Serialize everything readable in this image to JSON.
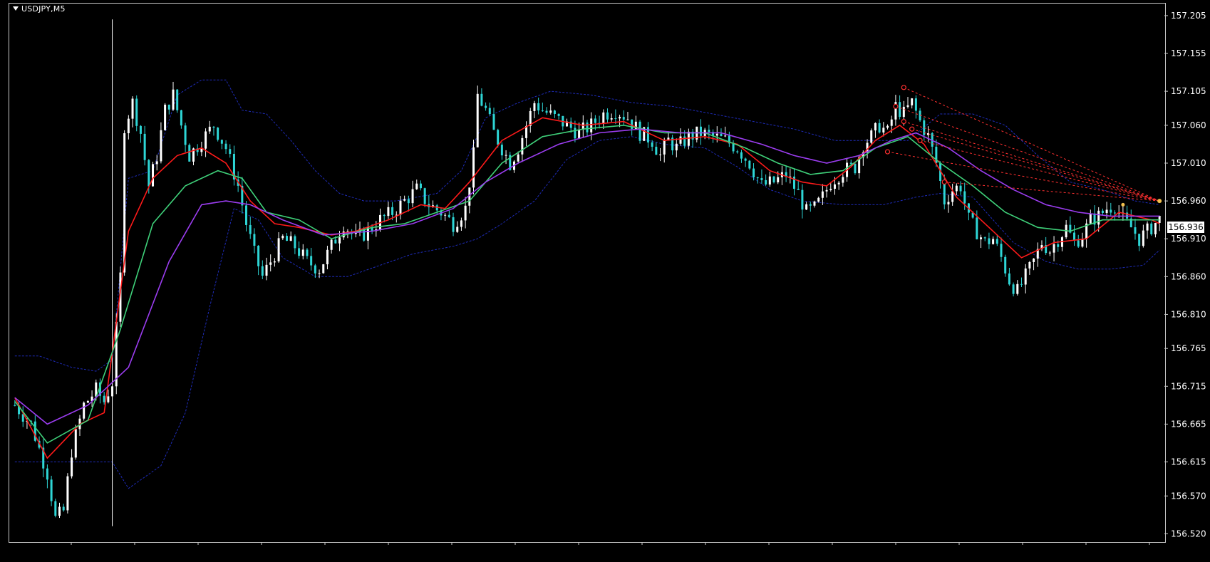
{
  "window": {
    "symbol_label": "USDJPY,M5"
  },
  "current_price": "156.936",
  "colors": {
    "background": "#000000",
    "bull_candle": "#ffffff",
    "bear_candle": "#2ed6d6",
    "ma_fast": "#ff1a1a",
    "ma_mid": "#3fd17a",
    "ma_slow": "#9b3df0",
    "bands": "#1e2bb8",
    "trend_lines": "#ff3030"
  },
  "chart_data": {
    "type": "candlestick",
    "symbol": "USDJPY",
    "timeframe": "M5",
    "ylim": [
      156.51,
      157.22
    ],
    "y_ticks": [
      "157.205",
      "157.155",
      "157.105",
      "157.060",
      "157.010",
      "156.960",
      "156.910",
      "156.860",
      "156.810",
      "156.765",
      "156.715",
      "156.665",
      "156.615",
      "156.570",
      "156.520"
    ],
    "close_path": [
      [
        0,
        156.69
      ],
      [
        4,
        156.665
      ],
      [
        8,
        156.6
      ],
      [
        10,
        156.54
      ],
      [
        12,
        156.55
      ],
      [
        14,
        156.63
      ],
      [
        17,
        156.69
      ],
      [
        20,
        156.71
      ],
      [
        22,
        156.695
      ],
      [
        24,
        156.72
      ],
      [
        26,
        156.86
      ],
      [
        27,
        157.06
      ],
      [
        29,
        157.09
      ],
      [
        31,
        157.05
      ],
      [
        33,
        156.98
      ],
      [
        35,
        157.02
      ],
      [
        37,
        157.08
      ],
      [
        39,
        157.1
      ],
      [
        41,
        157.06
      ],
      [
        43,
        157.02
      ],
      [
        46,
        157.04
      ],
      [
        49,
        157.06
      ],
      [
        52,
        157.03
      ],
      [
        55,
        156.98
      ],
      [
        57,
        156.93
      ],
      [
        59,
        156.89
      ],
      [
        61,
        156.86
      ],
      [
        63,
        156.88
      ],
      [
        66,
        156.91
      ],
      [
        69,
        156.9
      ],
      [
        72,
        156.88
      ],
      [
        75,
        156.87
      ],
      [
        78,
        156.9
      ],
      [
        81,
        156.93
      ],
      [
        84,
        156.91
      ],
      [
        87,
        156.92
      ],
      [
        90,
        156.935
      ],
      [
        93,
        156.945
      ],
      [
        96,
        156.96
      ],
      [
        99,
        156.975
      ],
      [
        102,
        156.955
      ],
      [
        105,
        156.945
      ],
      [
        108,
        156.93
      ],
      [
        111,
        156.95
      ],
      [
        113,
        157.02
      ],
      [
        114,
        157.1
      ],
      [
        116,
        157.08
      ],
      [
        118,
        157.05
      ],
      [
        120,
        157.03
      ],
      [
        122,
        157.01
      ],
      [
        124,
        157.03
      ],
      [
        126,
        157.06
      ],
      [
        128,
        157.09
      ],
      [
        130,
        157.08
      ],
      [
        133,
        157.07
      ],
      [
        136,
        157.06
      ],
      [
        139,
        157.05
      ],
      [
        142,
        157.06
      ],
      [
        145,
        157.075
      ],
      [
        148,
        157.08
      ],
      [
        151,
        157.07
      ],
      [
        154,
        157.05
      ],
      [
        157,
        157.04
      ],
      [
        159,
        157.02
      ],
      [
        161,
        157.04
      ],
      [
        163,
        157.03
      ],
      [
        166,
        157.045
      ],
      [
        169,
        157.05
      ],
      [
        172,
        157.045
      ],
      [
        175,
        157.04
      ],
      [
        178,
        157.03
      ],
      [
        181,
        157.01
      ],
      [
        184,
        156.98
      ],
      [
        187,
        156.985
      ],
      [
        190,
        156.995
      ],
      [
        193,
        156.97
      ],
      [
        195,
        156.945
      ],
      [
        197,
        156.95
      ],
      [
        199,
        156.965
      ],
      [
        201,
        156.985
      ],
      [
        204,
        157.0
      ],
      [
        207,
        157.005
      ],
      [
        209,
        157.035
      ],
      [
        211,
        157.045
      ],
      [
        213,
        157.06
      ],
      [
        215,
        157.05
      ],
      [
        217,
        157.085
      ],
      [
        219,
        157.075
      ],
      [
        221,
        157.09
      ],
      [
        223,
        157.065
      ],
      [
        225,
        157.045
      ],
      [
        227,
        157.01
      ],
      [
        229,
        156.96
      ],
      [
        231,
        156.975
      ],
      [
        233,
        156.98
      ],
      [
        235,
        156.935
      ],
      [
        237,
        156.92
      ],
      [
        239,
        156.905
      ],
      [
        241,
        156.91
      ],
      [
        243,
        156.885
      ],
      [
        245,
        156.855
      ],
      [
        247,
        156.84
      ],
      [
        249,
        156.86
      ],
      [
        251,
        156.88
      ],
      [
        253,
        156.905
      ],
      [
        255,
        156.895
      ],
      [
        257,
        156.91
      ],
      [
        259,
        156.925
      ],
      [
        261,
        156.905
      ],
      [
        263,
        156.915
      ],
      [
        265,
        156.935
      ],
      [
        267,
        156.94
      ],
      [
        269,
        156.95
      ],
      [
        271,
        156.955
      ],
      [
        273,
        156.935
      ],
      [
        275,
        156.925
      ],
      [
        277,
        156.91
      ],
      [
        279,
        156.92
      ],
      [
        282,
        156.936
      ]
    ],
    "moving_averages": [
      {
        "key": "ma_fast",
        "points": [
          [
            0,
            156.7
          ],
          [
            8,
            156.62
          ],
          [
            16,
            156.665
          ],
          [
            22,
            156.68
          ],
          [
            28,
            156.92
          ],
          [
            34,
            156.99
          ],
          [
            40,
            157.02
          ],
          [
            46,
            157.03
          ],
          [
            52,
            157.01
          ],
          [
            58,
            156.96
          ],
          [
            64,
            156.93
          ],
          [
            70,
            156.925
          ],
          [
            78,
            156.915
          ],
          [
            84,
            156.92
          ],
          [
            92,
            156.935
          ],
          [
            100,
            156.955
          ],
          [
            106,
            156.95
          ],
          [
            112,
            156.985
          ],
          [
            120,
            157.04
          ],
          [
            130,
            157.07
          ],
          [
            140,
            157.06
          ],
          [
            150,
            157.065
          ],
          [
            160,
            157.04
          ],
          [
            170,
            157.045
          ],
          [
            178,
            157.035
          ],
          [
            186,
            157.0
          ],
          [
            194,
            156.985
          ],
          [
            200,
            156.98
          ],
          [
            206,
            157.005
          ],
          [
            212,
            157.04
          ],
          [
            218,
            157.06
          ],
          [
            224,
            157.035
          ],
          [
            232,
            156.965
          ],
          [
            240,
            156.925
          ],
          [
            248,
            156.885
          ],
          [
            256,
            156.905
          ],
          [
            264,
            156.91
          ],
          [
            272,
            156.945
          ],
          [
            280,
            156.935
          ],
          [
            282,
            156.93
          ]
        ]
      },
      {
        "key": "ma_mid",
        "points": [
          [
            0,
            156.695
          ],
          [
            8,
            156.64
          ],
          [
            18,
            156.67
          ],
          [
            26,
            156.79
          ],
          [
            34,
            156.93
          ],
          [
            42,
            156.98
          ],
          [
            50,
            157.0
          ],
          [
            56,
            156.99
          ],
          [
            62,
            156.945
          ],
          [
            70,
            156.935
          ],
          [
            78,
            156.91
          ],
          [
            88,
            156.925
          ],
          [
            96,
            156.93
          ],
          [
            104,
            156.945
          ],
          [
            112,
            156.96
          ],
          [
            120,
            157.01
          ],
          [
            130,
            157.045
          ],
          [
            140,
            157.055
          ],
          [
            150,
            157.06
          ],
          [
            160,
            157.05
          ],
          [
            170,
            157.05
          ],
          [
            180,
            157.03
          ],
          [
            188,
            157.01
          ],
          [
            196,
            156.995
          ],
          [
            204,
            157.0
          ],
          [
            212,
            157.03
          ],
          [
            220,
            157.045
          ],
          [
            228,
            157.01
          ],
          [
            236,
            156.98
          ],
          [
            244,
            156.945
          ],
          [
            252,
            156.925
          ],
          [
            260,
            156.92
          ],
          [
            268,
            156.935
          ],
          [
            276,
            156.935
          ],
          [
            282,
            156.935
          ]
        ]
      },
      {
        "key": "ma_slow",
        "points": [
          [
            0,
            156.7
          ],
          [
            8,
            156.665
          ],
          [
            18,
            156.69
          ],
          [
            28,
            156.74
          ],
          [
            38,
            156.88
          ],
          [
            46,
            156.955
          ],
          [
            52,
            156.96
          ],
          [
            58,
            156.955
          ],
          [
            66,
            156.935
          ],
          [
            76,
            156.915
          ],
          [
            88,
            156.92
          ],
          [
            98,
            156.93
          ],
          [
            108,
            156.95
          ],
          [
            116,
            156.985
          ],
          [
            124,
            157.01
          ],
          [
            134,
            157.035
          ],
          [
            144,
            157.05
          ],
          [
            154,
            157.055
          ],
          [
            164,
            157.05
          ],
          [
            174,
            157.05
          ],
          [
            184,
            157.035
          ],
          [
            192,
            157.02
          ],
          [
            200,
            157.01
          ],
          [
            208,
            157.02
          ],
          [
            216,
            157.04
          ],
          [
            222,
            157.05
          ],
          [
            230,
            157.03
          ],
          [
            238,
            157.0
          ],
          [
            246,
            156.975
          ],
          [
            254,
            156.955
          ],
          [
            262,
            156.945
          ],
          [
            270,
            156.94
          ],
          [
            278,
            156.94
          ],
          [
            282,
            156.94
          ]
        ]
      }
    ],
    "bands": [
      {
        "key": "upper",
        "points": [
          [
            0,
            156.755
          ],
          [
            6,
            156.755
          ],
          [
            14,
            156.74
          ],
          [
            20,
            156.735
          ],
          [
            24,
            156.75
          ],
          [
            28,
            156.99
          ],
          [
            34,
            157.0
          ],
          [
            40,
            157.1
          ],
          [
            46,
            157.12
          ],
          [
            52,
            157.12
          ],
          [
            56,
            157.08
          ],
          [
            62,
            157.075
          ],
          [
            68,
            157.04
          ],
          [
            74,
            157.0
          ],
          [
            80,
            156.97
          ],
          [
            86,
            156.96
          ],
          [
            94,
            156.96
          ],
          [
            104,
            156.97
          ],
          [
            110,
            157.0
          ],
          [
            116,
            157.07
          ],
          [
            124,
            157.09
          ],
          [
            132,
            157.105
          ],
          [
            142,
            157.1
          ],
          [
            152,
            157.09
          ],
          [
            162,
            157.085
          ],
          [
            172,
            157.075
          ],
          [
            182,
            157.065
          ],
          [
            192,
            157.055
          ],
          [
            202,
            157.04
          ],
          [
            212,
            157.04
          ],
          [
            220,
            157.04
          ],
          [
            228,
            157.075
          ],
          [
            236,
            157.075
          ],
          [
            244,
            157.06
          ],
          [
            252,
            157.02
          ],
          [
            260,
            156.985
          ],
          [
            268,
            156.975
          ],
          [
            276,
            156.96
          ],
          [
            282,
            156.955
          ]
        ]
      },
      {
        "key": "lower",
        "points": [
          [
            0,
            156.615
          ],
          [
            10,
            156.615
          ],
          [
            18,
            156.615
          ],
          [
            24,
            156.615
          ],
          [
            28,
            156.58
          ],
          [
            36,
            156.61
          ],
          [
            42,
            156.68
          ],
          [
            48,
            156.82
          ],
          [
            54,
            156.95
          ],
          [
            60,
            156.935
          ],
          [
            66,
            156.885
          ],
          [
            74,
            156.86
          ],
          [
            82,
            156.86
          ],
          [
            90,
            156.875
          ],
          [
            98,
            156.89
          ],
          [
            108,
            156.9
          ],
          [
            114,
            156.91
          ],
          [
            120,
            156.93
          ],
          [
            128,
            156.96
          ],
          [
            136,
            157.015
          ],
          [
            144,
            157.04
          ],
          [
            152,
            157.045
          ],
          [
            160,
            157.035
          ],
          [
            170,
            157.03
          ],
          [
            178,
            157.005
          ],
          [
            186,
            156.975
          ],
          [
            194,
            156.96
          ],
          [
            204,
            156.955
          ],
          [
            214,
            156.955
          ],
          [
            222,
            156.965
          ],
          [
            228,
            156.97
          ],
          [
            236,
            156.965
          ],
          [
            246,
            156.905
          ],
          [
            254,
            156.88
          ],
          [
            262,
            156.87
          ],
          [
            270,
            156.87
          ],
          [
            278,
            156.875
          ],
          [
            282,
            156.895
          ]
        ]
      }
    ],
    "trend_lines": [
      {
        "from": [
          219,
          157.11
        ],
        "to": [
          282,
          156.96
        ]
      },
      {
        "from": [
          217,
          157.085
        ],
        "to": [
          282,
          156.96
        ]
      },
      {
        "from": [
          219,
          157.065
        ],
        "to": [
          282,
          156.96
        ]
      },
      {
        "from": [
          221,
          157.055
        ],
        "to": [
          282,
          156.96
        ]
      },
      {
        "from": [
          223,
          157.04
        ],
        "to": [
          282,
          156.96
        ]
      },
      {
        "from": [
          215,
          157.025
        ],
        "to": [
          282,
          156.96
        ]
      },
      {
        "from": [
          229,
          156.985
        ],
        "to": [
          282,
          156.96
        ]
      }
    ]
  }
}
